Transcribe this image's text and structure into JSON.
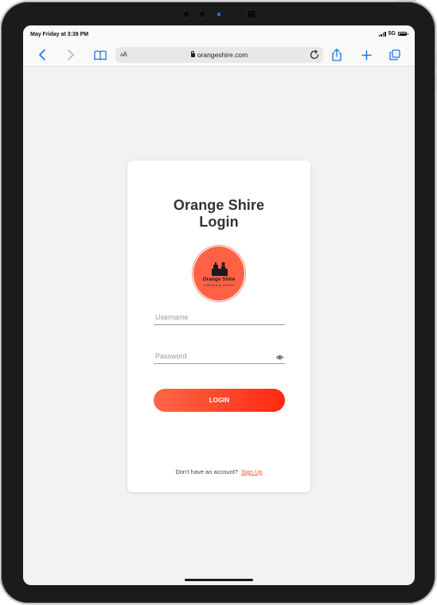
{
  "status_bar": {
    "time": "May Friday at 3:39 PM",
    "network": "5G"
  },
  "browser": {
    "text_size_label_small": "A",
    "text_size_label_large": "A",
    "url": "orangeshire.com",
    "icons": [
      "back-icon",
      "forward-icon",
      "bookmarks-icon",
      "lock-icon",
      "reload-icon",
      "share-icon",
      "new-tab-icon",
      "tabs-icon"
    ]
  },
  "login": {
    "title_line1": "Orange Shire",
    "title_line2": "Login",
    "logo_name": "Orange Shire",
    "logo_tagline": "Community Center",
    "username_placeholder": "Username",
    "password_placeholder": "Password",
    "login_button": "LOGIN",
    "no_account_text": "Don't have an account?",
    "signup_link": "Sign Up"
  },
  "colors": {
    "accent": "#ff5533",
    "logo_background": "#ff6144",
    "browser_blue": "#1a73e8"
  }
}
